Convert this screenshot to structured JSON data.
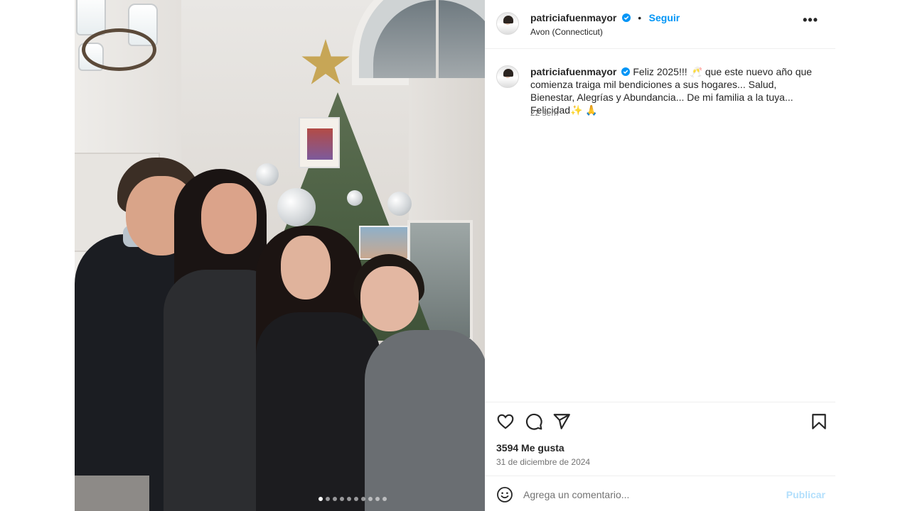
{
  "post": {
    "username": "patriciafuenmayor",
    "follow_separator": "•",
    "follow_label": "Seguir",
    "location": "Avon (Connecticut)",
    "more_label": "•••",
    "caption_text": "Feliz 2025!!! 🥂 que este nuevo año que comienza traiga mil bendiciones a sus hogares... Salud, Bienestar, Alegrías y Abundancia... De mi familia a la tuya... Felicidad✨ 🙏",
    "caption_time": "22 sem",
    "likes": "3594 Me gusta",
    "date": "31 de diciembre de 2024"
  },
  "carousel": {
    "next_label": "›",
    "slide_count": 10,
    "active_slide": 1
  },
  "comment": {
    "placeholder": "Agrega un comentario...",
    "publish_label": "Publicar"
  },
  "icons": {
    "verified": "verified-badge-icon",
    "like": "heart-icon",
    "comment": "comment-icon",
    "share": "share-icon",
    "save": "bookmark-icon",
    "emoji": "emoji-icon",
    "more": "more-options-icon"
  },
  "colors": {
    "link_blue": "#0095f6",
    "publish_disabled": "#b2dffc",
    "secondary_text": "#737373",
    "primary_text": "#262626",
    "divider": "#efefef"
  }
}
